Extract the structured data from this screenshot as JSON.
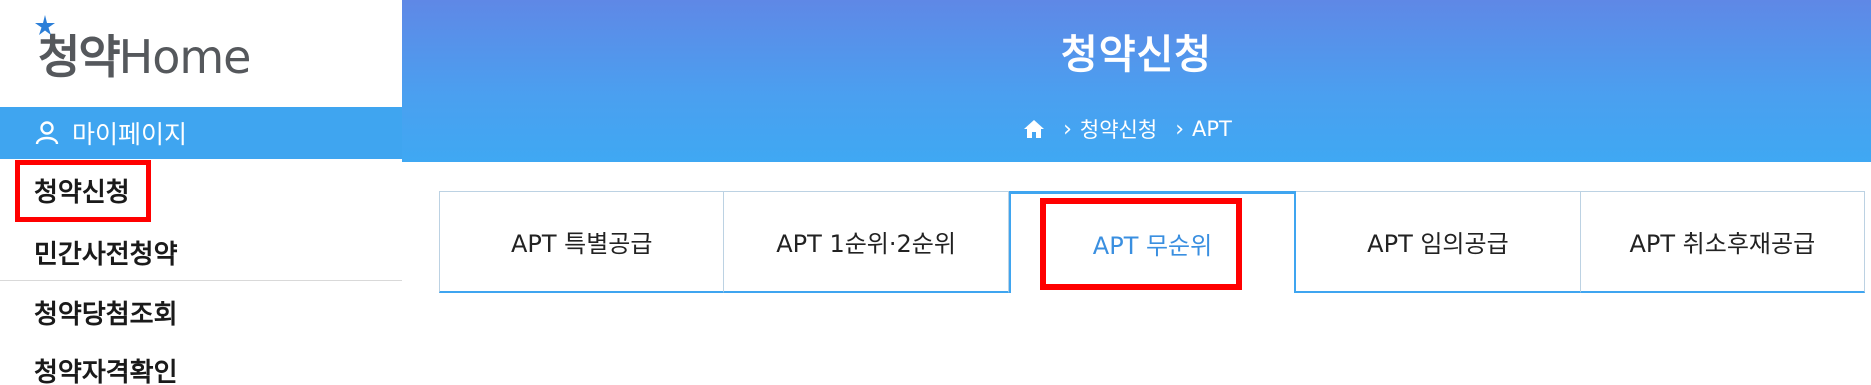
{
  "logo": {
    "text_ko": "청약",
    "text_en": "Home"
  },
  "sidebar": {
    "mypage_label": "마이페이지",
    "items": [
      {
        "label": "청약신청"
      },
      {
        "label": "민간사전청약"
      },
      {
        "label": "청약당첨조회"
      },
      {
        "label": "청약자격확인"
      }
    ]
  },
  "header": {
    "title": "청약신청",
    "breadcrumb": [
      "청약신청",
      "APT"
    ]
  },
  "tabs": [
    {
      "label": "APT 특별공급"
    },
    {
      "label": "APT 1순위·2순위"
    },
    {
      "label": "APT 무순위",
      "active": true
    },
    {
      "label": "APT 임의공급"
    },
    {
      "label": "APT 취소후재공급"
    }
  ],
  "colors": {
    "accent": "#3fa5f0",
    "highlight": "#ff0000"
  },
  "icons": {
    "home": "home-icon",
    "user": "user-icon",
    "logo": "logo-star-icon"
  }
}
